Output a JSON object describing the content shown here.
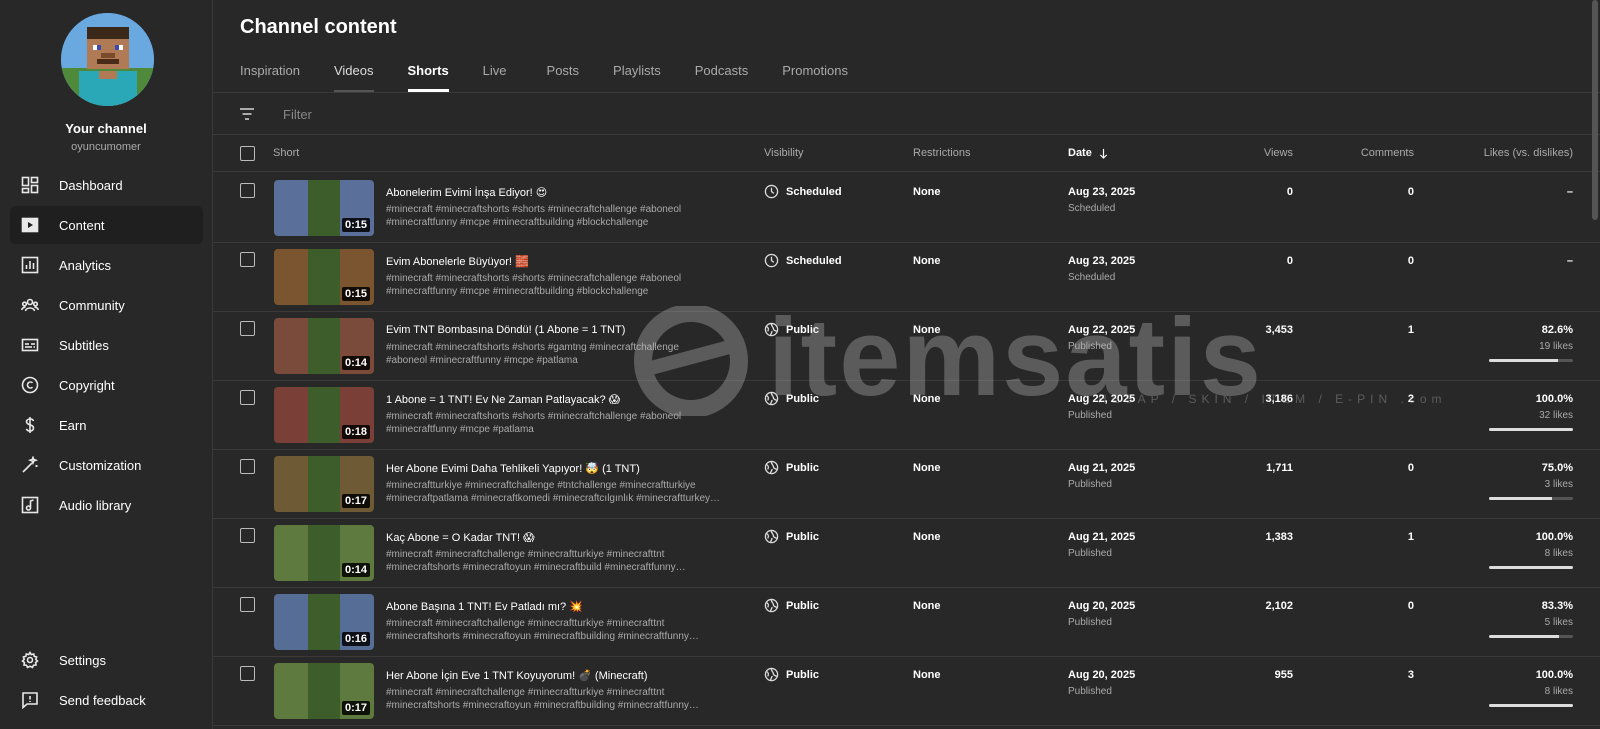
{
  "channel": {
    "title": "Your channel",
    "handle": "oyuncumomer"
  },
  "nav": [
    {
      "label": "Dashboard",
      "icon": "dashboard-icon"
    },
    {
      "label": "Content",
      "icon": "content-icon",
      "active": true
    },
    {
      "label": "Analytics",
      "icon": "analytics-icon"
    },
    {
      "label": "Community",
      "icon": "community-icon"
    },
    {
      "label": "Subtitles",
      "icon": "subtitles-icon"
    },
    {
      "label": "Copyright",
      "icon": "copyright-icon"
    },
    {
      "label": "Earn",
      "icon": "earn-icon"
    },
    {
      "label": "Customization",
      "icon": "customization-icon"
    },
    {
      "label": "Audio library",
      "icon": "audio-library-icon"
    }
  ],
  "nav_bottom": [
    {
      "label": "Settings",
      "icon": "settings-icon"
    },
    {
      "label": "Send feedback",
      "icon": "feedback-icon"
    }
  ],
  "page_title": "Channel content",
  "tabs": [
    "Inspiration",
    "Videos",
    "Shorts",
    "Live",
    "Posts",
    "Playlists",
    "Podcasts",
    "Promotions"
  ],
  "active_tab": "Shorts",
  "filter": {
    "placeholder": "Filter"
  },
  "columns": {
    "short": "Short",
    "visibility": "Visibility",
    "restrictions": "Restrictions",
    "date": "Date",
    "views": "Views",
    "comments": "Comments",
    "likes": "Likes (vs. dislikes)"
  },
  "watermark": {
    "text": "itemsatis",
    "sub": "HESAP / SKIN / ITEM / E-PIN .com"
  },
  "rows": [
    {
      "title": "Abonelerim Evimi İnşa Ediyor! 😍",
      "desc1": "#minecraft #minecraftshorts #shorts #minecraftchallenge #aboneol",
      "desc2": "#minecraftfunny #mcpe #minecraftbuilding #blockchallenge",
      "duration": "0:15",
      "visibility": "Scheduled",
      "restrictions": "None",
      "date": "Aug 23, 2025",
      "date_status": "Scheduled",
      "views": "0",
      "comments": "0",
      "likes": "–",
      "likes_count": "",
      "likes_ratio": null,
      "thumb_color": "#5a6f9a"
    },
    {
      "title": "Evim Abonelerle Büyüyor! 🧱",
      "desc1": "#minecraft #minecraftshorts #shorts #minecraftchallenge #aboneol",
      "desc2": "#minecraftfunny #mcpe #minecraftbuilding #blockchallenge",
      "duration": "0:15",
      "visibility": "Scheduled",
      "restrictions": "None",
      "date": "Aug 23, 2025",
      "date_status": "Scheduled",
      "views": "0",
      "comments": "0",
      "likes": "–",
      "likes_count": "",
      "likes_ratio": null,
      "thumb_color": "#7a5530"
    },
    {
      "title": "Evim TNT Bombasına Döndü! (1 Abone = 1 TNT)",
      "desc1": "#minecraft #minecraftshorts #shorts #gamtng #minecraftchallenge",
      "desc2": "#aboneol #minecraftfunny #mcpe #patlama",
      "duration": "0:14",
      "visibility": "Public",
      "restrictions": "None",
      "date": "Aug 22, 2025",
      "date_status": "Published",
      "views": "3,453",
      "comments": "1",
      "likes": "82.6%",
      "likes_count": "19 likes",
      "likes_ratio": 0.826,
      "thumb_color": "#7a4a3a"
    },
    {
      "title": "1 Abone = 1 TNT! Ev Ne Zaman Patlayacak? 😱",
      "desc1": "#minecraft #minecraftshorts #shorts #minecraftchallenge #aboneol",
      "desc2": "#minecraftfunny #mcpe #patlama",
      "duration": "0:18",
      "visibility": "Public",
      "restrictions": "None",
      "date": "Aug 22, 2025",
      "date_status": "Published",
      "views": "3,186",
      "comments": "2",
      "likes": "100.0%",
      "likes_count": "32 likes",
      "likes_ratio": 1.0,
      "thumb_color": "#7a4038"
    },
    {
      "title": "Her Abone Evimi Daha Tehlikeli Yapıyor! 🤯 (1 TNT)",
      "desc1": "#minecraftturkiye #minecraftchallenge #tntchallenge #minecraftturkiye",
      "desc2": "#minecraftpatlama #minecraftkomedi #minecraftcılgınlık #minecraftturkey…",
      "duration": "0:17",
      "visibility": "Public",
      "restrictions": "None",
      "date": "Aug 21, 2025",
      "date_status": "Published",
      "views": "1,711",
      "comments": "0",
      "likes": "75.0%",
      "likes_count": "3 likes",
      "likes_ratio": 0.75,
      "thumb_color": "#6e5a34"
    },
    {
      "title": "Kaç Abone = O Kadar TNT! 😱",
      "desc1": "#minecraft #minecraftchallenge #minecraftturkiye #minecrafttnt",
      "desc2": "#minecraftshorts #minecraftoyun #minecraftbuild #minecraftfunny…",
      "duration": "0:14",
      "visibility": "Public",
      "restrictions": "None",
      "date": "Aug 21, 2025",
      "date_status": "Published",
      "views": "1,383",
      "comments": "1",
      "likes": "100.0%",
      "likes_count": "8 likes",
      "likes_ratio": 1.0,
      "thumb_color": "#5f7a3e"
    },
    {
      "title": "Abone Başına 1 TNT! Ev Patladı mı? 💥",
      "desc1": "#minecraft #minecraftchallenge #minecraftturkiye #minecrafttnt",
      "desc2": "#minecraftshorts #minecraftoyun #minecraftbuilding #minecraftfunny…",
      "duration": "0:16",
      "visibility": "Public",
      "restrictions": "None",
      "date": "Aug 20, 2025",
      "date_status": "Published",
      "views": "2,102",
      "comments": "0",
      "likes": "83.3%",
      "likes_count": "5 likes",
      "likes_ratio": 0.833,
      "thumb_color": "#566e96"
    },
    {
      "title": "Her Abone İçin Eve 1 TNT Koyuyorum! 💣 (Minecraft)",
      "desc1": "#minecraft #minecraftchallenge #minecraftturkiye #minecrafttnt",
      "desc2": "#minecraftshorts #minecraftoyun #minecraftbuilding #minecraftfunny…",
      "duration": "0:17",
      "visibility": "Public",
      "restrictions": "None",
      "date": "Aug 20, 2025",
      "date_status": "Published",
      "views": "955",
      "comments": "3",
      "likes": "100.0%",
      "likes_count": "8 likes",
      "likes_ratio": 1.0,
      "thumb_color": "#5f7a3e"
    }
  ]
}
